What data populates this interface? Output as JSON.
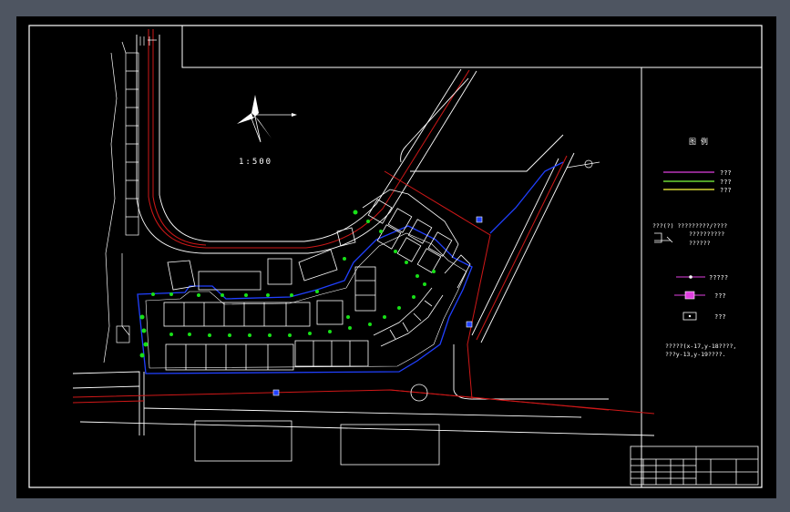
{
  "drawing": {
    "scale_label": "1:500",
    "colors": {
      "background": "#000000",
      "frame": "#ffffff",
      "road_edge": "#ffffff",
      "road_centerline": "#d01818",
      "water_pipe": "#2040ff",
      "vegetation": "#18e018",
      "legend_magenta": "#e040e0",
      "legend_green": "#80ff40",
      "legend_yellow": "#ffff40"
    },
    "north_arrow_icon": "north-arrow-icon"
  },
  "legend": {
    "title": "图  例",
    "line_items": [
      {
        "label": "???",
        "color": "#e040e0"
      },
      {
        "label": "???",
        "color": "#80ff40"
      },
      {
        "label": "???",
        "color": "#ffff40"
      }
    ],
    "note_line1": "???(?)  ?????????/????",
    "note_line2": "??????????",
    "note_line3": "??????",
    "symbols": [
      {
        "label": "?????",
        "icon": "valve-icon"
      },
      {
        "label": "???",
        "icon": "hydrant-icon"
      },
      {
        "label": "???",
        "icon": "well-icon"
      }
    ],
    "coord_line1": "?????(x-17,y-18????,",
    "coord_line2": "???y-13,y-19????."
  }
}
